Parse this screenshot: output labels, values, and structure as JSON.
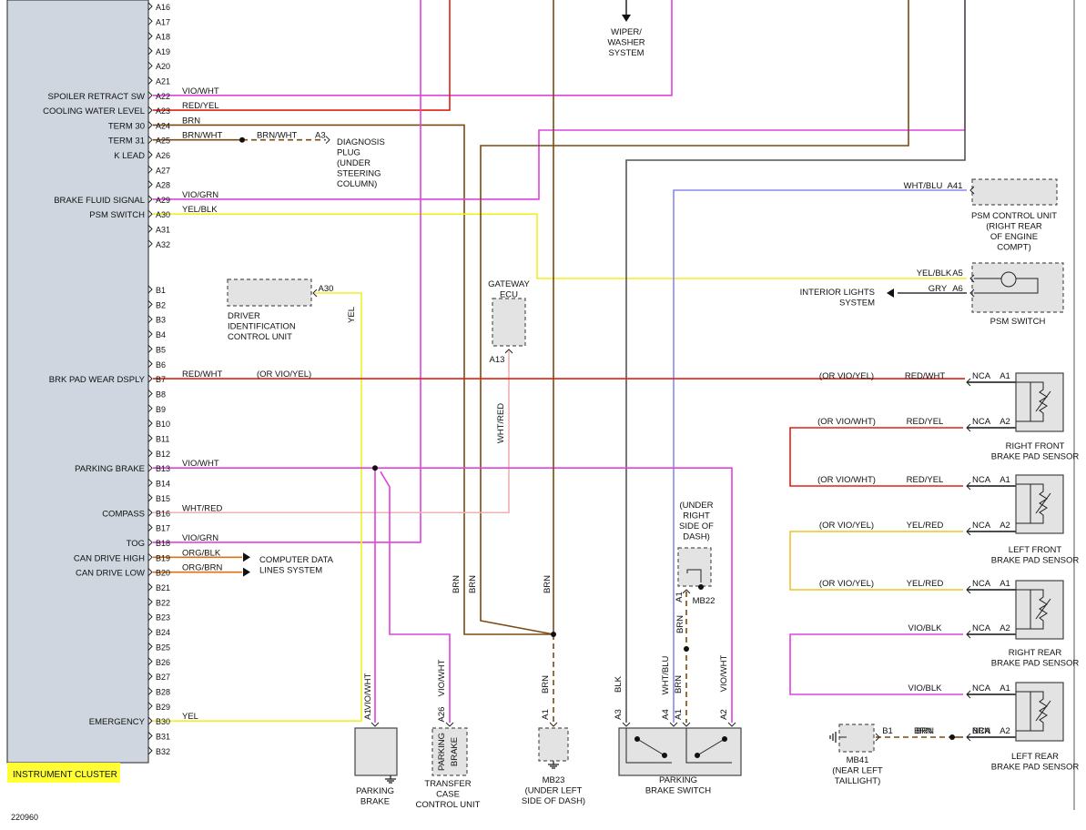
{
  "cluster": {
    "title": "INSTRUMENT CLUSTER",
    "highlight_color": "#ffff33",
    "pins": [
      "A16",
      "A17",
      "A18",
      "A19",
      "A20",
      "A21",
      "A22",
      "A23",
      "A24",
      "A25",
      "A26",
      "A27",
      "A28",
      "A29",
      "A30",
      "A31",
      "A32",
      "B1",
      "B2",
      "B3",
      "B4",
      "B5",
      "B6",
      "B7",
      "B8",
      "B9",
      "B10",
      "B11",
      "B12",
      "B13",
      "B14",
      "B15",
      "B16",
      "B17",
      "B18",
      "B19",
      "B20",
      "B21",
      "B22",
      "B23",
      "B24",
      "B25",
      "B26",
      "B27",
      "B28",
      "B29",
      "B30",
      "B31",
      "B32"
    ],
    "functions": {
      "A22": "SPOILER RETRACT SW",
      "A23": "COOLING WATER LEVEL",
      "A24": "TERM 30",
      "A25": "TERM 31",
      "A26": "K LEAD",
      "A29": "BRAKE FLUID SIGNAL",
      "A30": "PSM SWITCH",
      "B7": "BRK PAD WEAR DSPLY",
      "B13": "PARKING BRAKE",
      "B16": "COMPASS",
      "B18": "TOG",
      "B19": "CAN DRIVE HIGH",
      "B20": "CAN DRIVE LOW",
      "B30": "EMERGENCY"
    },
    "wires": {
      "A22": "VIO/WHT",
      "A23": "RED/YEL",
      "A24": "BRN",
      "A25": "BRN/WHT",
      "A29": "VIO/GRN",
      "A30": "YEL/BLK",
      "B7": "RED/WHT",
      "B13": "VIO/WHT",
      "B16": "WHT/RED",
      "B18": "VIO/GRN",
      "B19": "ORG/BLK",
      "B20": "ORG/BRN",
      "B30": "YEL"
    }
  },
  "figure_id": "220960",
  "colors": {
    "vio": "#e040e0",
    "red": "#e02010",
    "brn": "#7a4a10",
    "yel": "#f0f020",
    "blk": "#555555",
    "blu": "#8888ee",
    "wred": "#f0b0b0",
    "org": "#e07010",
    "oyel": "#f0c030",
    "comp": "#cccccc"
  },
  "texts": {
    "b7_alt": "(OR VIO/YEL)",
    "diag_wire": "BRN/WHT",
    "diag_pin": "A3",
    "diag_label": [
      "DIAGNOSIS",
      "PLUG",
      "(UNDER",
      "STEERING",
      "COLUMN)"
    ],
    "wiper": [
      "WIPER/",
      "WASHER",
      "SYSTEM"
    ],
    "can_dest": [
      "COMPUTER DATA",
      "LINES SYSTEM"
    ],
    "driver_pin": "A30",
    "driver_wire": "YEL",
    "driver_label": [
      "DRIVER",
      "IDENTIFICATION",
      "CONTROL UNIT"
    ],
    "gateway_label": [
      "GATEWAY",
      "ECU"
    ],
    "gateway_pin": "A13",
    "gateway_wire": "WHT/RED",
    "psm_cu_wire": "WHT/BLU",
    "psm_cu_pin": "A41",
    "psm_cu_label": [
      "PSM CONTROL UNIT",
      "(RIGHT REAR",
      "OF ENGINE",
      "COMPT)"
    ],
    "psm_sw_w1": "YEL/BLK",
    "psm_sw_p1": "A5",
    "psm_sw_w2": "GRY",
    "psm_sw_p2": "A6",
    "interior": [
      "INTERIOR LIGHTS",
      "SYSTEM"
    ],
    "psm_sw_label": "PSM SWITCH",
    "nca": "NCA",
    "a1": "A1",
    "a2": "A2",
    "rf_w1": "RED/WHT",
    "rf_alt1": "(OR VIO/YEL)",
    "rf_w2": "RED/YEL",
    "rf_alt2": "(OR VIO/WHT)",
    "rf_label": [
      "RIGHT FRONT",
      "BRAKE PAD SENSOR"
    ],
    "lf_w1": "RED/YEL",
    "lf_alt1": "(OR VIO/WHT)",
    "lf_w2": "YEL/RED",
    "lf_alt2": "(OR VIO/YEL)",
    "lf_label": [
      "LEFT FRONT",
      "BRAKE PAD SENSOR"
    ],
    "rr_w1": "YEL/RED",
    "rr_alt1": "(OR VIO/YEL)",
    "rr_w2": "VIO/BLK",
    "rr_label": [
      "RIGHT REAR",
      "BRAKE PAD SENSOR"
    ],
    "lr_w1": "VIO/BLK",
    "lr_w2": "BRN",
    "lr_label": [
      "LEFT REAR",
      "BRAKE PAD SENSOR"
    ],
    "mb41_pin": "B1",
    "mb41_w": "BRN",
    "mb41_w2": "BRN",
    "mb41_label": [
      "MB41",
      "(NEAR LEFT",
      "TAILLIGHT)"
    ],
    "brn": "BRN",
    "park_pin": "A1",
    "park_wire": "VIO/WHT",
    "park_label": [
      "PARKING",
      "BRAKE"
    ],
    "tc_pin": "A26",
    "tc_wire": "VIO/WHT",
    "tc_inner": [
      "PARKING",
      "BRAKE"
    ],
    "tc_label": [
      "TRANSFER",
      "CASE",
      "CONTROL UNIT"
    ],
    "mb23_pin": "A1",
    "mb23_wire": "BRN",
    "mb23_label": [
      "MB23",
      "(UNDER LEFT",
      "SIDE OF DASH)"
    ],
    "mb22_head": [
      "(UNDER",
      "RIGHT",
      "SIDE OF",
      "DASH)"
    ],
    "mb22_pin": "A1",
    "mb22_name": "MB22",
    "mb22_wire": "BRN",
    "pbs_pins": [
      "A3",
      "A4",
      "A1",
      "A2"
    ],
    "pbs_wires": [
      "BLK",
      "WHT/BLU",
      "BRN",
      "VIO/WHT"
    ],
    "pbs_label": [
      "PARKING",
      "BRAKE SWITCH"
    ]
  }
}
